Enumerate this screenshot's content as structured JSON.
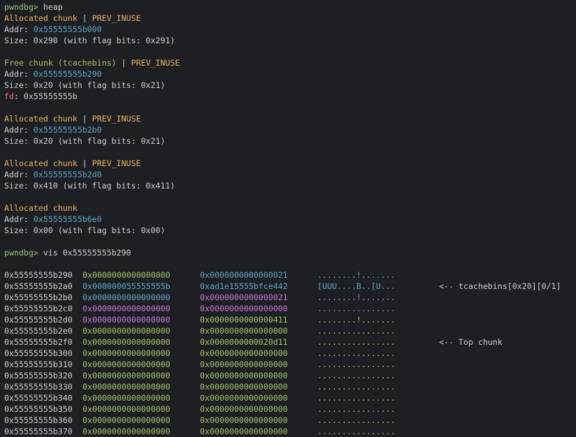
{
  "terminal": {
    "prompt": "pwndbg>",
    "command1": " heap",
    "command2": " vis 0x55555555b290"
  },
  "chunks": [
    {
      "title": "Allocated chunk",
      "title_color": "#e5b567",
      "sep": " | ",
      "flag": "PREV_INUSE",
      "addr_label": "Addr:",
      "addr": "0x55555555b000",
      "size_line": "Size: 0x290 (with flag bits: 0x291)"
    },
    {
      "title": "Free chunk (tcachebins)",
      "title_color": "#a6c56b",
      "sep": " | ",
      "flag": "PREV_INUSE",
      "addr_label": "Addr:",
      "addr": "0x55555555b290",
      "size_line": "Size: 0x20 (with flag bits: 0x21)",
      "fd_label": "fd",
      "fd_value": ": 0x55555555b"
    },
    {
      "title": "Allocated chunk",
      "title_color": "#e5b567",
      "sep": " | ",
      "flag": "PREV_INUSE",
      "addr_label": "Addr:",
      "addr": "0x55555555b2b0",
      "size_line": "Size: 0x20 (with flag bits: 0x21)"
    },
    {
      "title": "Allocated chunk",
      "title_color": "#e5b567",
      "sep": " | ",
      "flag": "PREV_INUSE",
      "addr_label": "Addr:",
      "addr": "0x55555555b2d0",
      "size_line": "Size: 0x410 (with flag bits: 0x411)"
    },
    {
      "title": "Allocated chunk",
      "title_color": "#e5b567",
      "sep": "",
      "flag": "",
      "addr_label": "Addr:",
      "addr": "0x55555555b6e0",
      "size_line": "Size: 0x00 (with flag bits: 0x00)"
    }
  ],
  "vis_rows": [
    {
      "addr": "0x55555555b290",
      "q1": "0x0000000000000000",
      "q1c": "#a6c56b",
      "q2": "0x0000000000000021",
      "q2c": "#5fa8c8",
      "ascii": "........!.......",
      "asciic": "#5fa8c8",
      "note": ""
    },
    {
      "addr": "0x55555555b2a0",
      "q1": "0x000000055555555b",
      "q1c": "#5fa8c8",
      "q2": "0xad1e15555bfce442",
      "q2c": "#5fa8c8",
      "ascii": "[UUU....B..[U...",
      "asciic": "#5fa8c8",
      "note": "<-- tcachebins[0x20][0/1]"
    },
    {
      "addr": "0x55555555b2b0",
      "q1": "0x0000000000000000",
      "q1c": "#5fa8c8",
      "q2": "0x0000000000000021",
      "q2c": "#c678dd",
      "ascii": "........!.......",
      "asciic": "#c678dd",
      "note": ""
    },
    {
      "addr": "0x55555555b2c0",
      "q1": "0x0000000000000000",
      "q1c": "#c678dd",
      "q2": "0x0000000000000000",
      "q2c": "#c678dd",
      "ascii": "................",
      "asciic": "#c678dd",
      "note": ""
    },
    {
      "addr": "0x55555555b2d0",
      "q1": "0x0000000000000000",
      "q1c": "#c678dd",
      "q2": "0x0000000000000411",
      "q2c": "#a6c56b",
      "ascii": "........!.......",
      "asciic": "#a6c56b",
      "note": ""
    },
    {
      "addr": "0x55555555b2e0",
      "q1": "0x0000000000000000",
      "q1c": "#a6c56b",
      "q2": "0x0000000000000000",
      "q2c": "#a6c56b",
      "ascii": "................",
      "asciic": "#a6c56b",
      "note": ""
    },
    {
      "addr": "0x55555555b2f0",
      "q1": "0x0000000000000000",
      "q1c": "#a6c56b",
      "q2": "0x0000000000020d11",
      "q2c": "#a6c56b",
      "ascii": "................",
      "asciic": "#a6c56b",
      "note": "<-- Top chunk"
    },
    {
      "addr": "0x55555555b300",
      "q1": "0x0000000000000000",
      "q1c": "#a6c56b",
      "q2": "0x0000000000000000",
      "q2c": "#a6c56b",
      "ascii": "................",
      "asciic": "#a6c56b",
      "note": ""
    },
    {
      "addr": "0x55555555b310",
      "q1": "0x0000000000000000",
      "q1c": "#a6c56b",
      "q2": "0x0000000000000000",
      "q2c": "#a6c56b",
      "ascii": "................",
      "asciic": "#a6c56b",
      "note": ""
    },
    {
      "addr": "0x55555555b320",
      "q1": "0x0000000000000000",
      "q1c": "#a6c56b",
      "q2": "0x0000000000000000",
      "q2c": "#a6c56b",
      "ascii": "................",
      "asciic": "#a6c56b",
      "note": ""
    },
    {
      "addr": "0x55555555b330",
      "q1": "0x0000000000000000",
      "q1c": "#a6c56b",
      "q2": "0x0000000000000000",
      "q2c": "#a6c56b",
      "ascii": "................",
      "asciic": "#a6c56b",
      "note": ""
    },
    {
      "addr": "0x55555555b340",
      "q1": "0x0000000000000000",
      "q1c": "#a6c56b",
      "q2": "0x0000000000000000",
      "q2c": "#a6c56b",
      "ascii": "................",
      "asciic": "#a6c56b",
      "note": ""
    },
    {
      "addr": "0x55555555b350",
      "q1": "0x0000000000000000",
      "q1c": "#a6c56b",
      "q2": "0x0000000000000000",
      "q2c": "#a6c56b",
      "ascii": "................",
      "asciic": "#a6c56b",
      "note": ""
    },
    {
      "addr": "0x55555555b360",
      "q1": "0x0000000000000000",
      "q1c": "#a6c56b",
      "q2": "0x0000000000000000",
      "q2c": "#a6c56b",
      "ascii": "................",
      "asciic": "#a6c56b",
      "note": ""
    },
    {
      "addr": "0x55555555b370",
      "q1": "0x0000000000000000",
      "q1c": "#a6c56b",
      "q2": "0x0000000000000000",
      "q2c": "#a6c56b",
      "ascii": "................",
      "asciic": "#a6c56b",
      "note": ""
    }
  ]
}
